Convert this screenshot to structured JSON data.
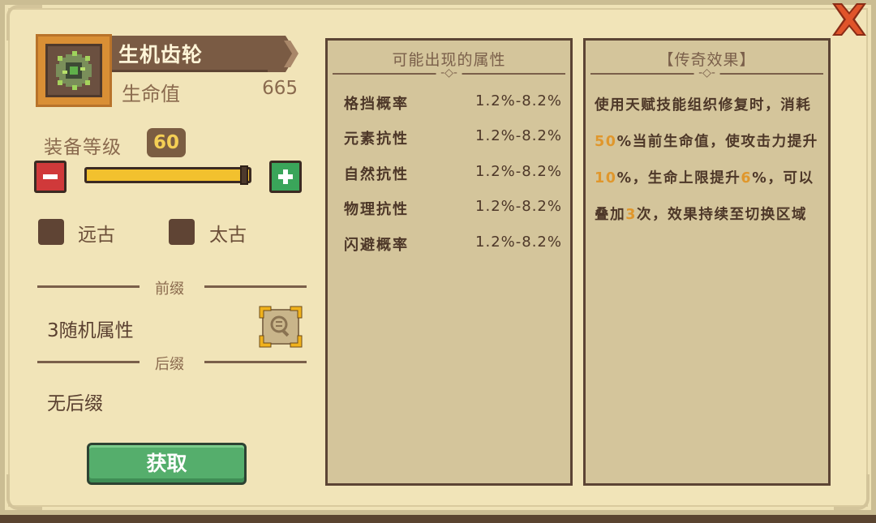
{
  "item": {
    "name": "生机齿轮",
    "stat_label": "生命值",
    "stat_value": "665",
    "icon": "gear-with-vines-icon"
  },
  "level": {
    "label": "装备等级",
    "value": "60",
    "slider_fraction": 1.0,
    "minus_icon": "minus-icon",
    "plus_icon": "plus-icon"
  },
  "options": [
    {
      "label": "远古",
      "checked": false
    },
    {
      "label": "太古",
      "checked": false
    }
  ],
  "prefix": {
    "heading": "前缀",
    "value": "3随机属性",
    "detail_icon": "magnifier-icon"
  },
  "suffix": {
    "heading": "后缀",
    "value": "无后缀"
  },
  "action": {
    "label": "获取"
  },
  "attributes_panel": {
    "title": "可能出现的属性",
    "ornament": "-◇-",
    "rows": [
      {
        "name": "格挡概率",
        "range": "1.2%-8.2%"
      },
      {
        "name": "元素抗性",
        "range": "1.2%-8.2%"
      },
      {
        "name": "自然抗性",
        "range": "1.2%-8.2%"
      },
      {
        "name": "物理抗性",
        "range": "1.2%-8.2%"
      },
      {
        "name": "闪避概率",
        "range": "1.2%-8.2%"
      }
    ]
  },
  "legend_panel": {
    "title": "【传奇效果】",
    "ornament": "-◇-",
    "text_parts": [
      {
        "t": "使用天赋技能组织修复时，消耗",
        "hl": false
      },
      {
        "t": "50",
        "hl": true
      },
      {
        "t": "%当前生命值，使攻击力提升",
        "hl": false
      },
      {
        "t": "10",
        "hl": true
      },
      {
        "t": "%，生命上限提升",
        "hl": false
      },
      {
        "t": "6",
        "hl": true
      },
      {
        "t": "%，可以叠加",
        "hl": false
      },
      {
        "t": "3",
        "hl": true
      },
      {
        "t": "次，效果持续至切换区域",
        "hl": false
      }
    ]
  },
  "colors": {
    "parchment": "#f1e4b8",
    "panel": "#d4c59b",
    "highlight": "#e0972c",
    "level_badge_text": "#f4cf55",
    "get_button": "#55ae6c",
    "close_icon": "#e0542a"
  },
  "close_icon": "close-x-icon"
}
